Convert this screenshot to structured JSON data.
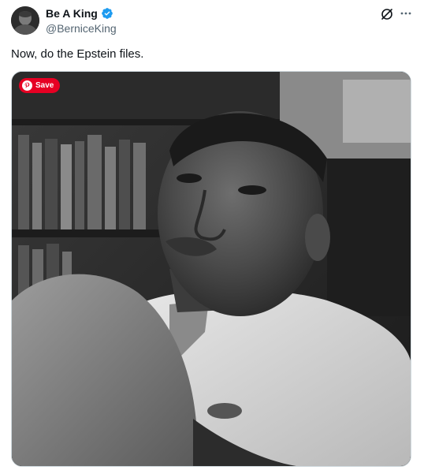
{
  "author": {
    "display_name": "Be A King",
    "handle": "@BerniceKing",
    "verified": true,
    "avatar_icon": "profile-photo"
  },
  "post": {
    "text": "Now, do the Epstein files."
  },
  "media": {
    "save_label": "Save",
    "save_color": "#e60023",
    "overlay_icon": "pinterest-icon"
  },
  "header_icons": [
    "grok-icon",
    "more-icon"
  ],
  "colors": {
    "text": "#0f1419",
    "secondary": "#536471",
    "verified": "#1d9bf0",
    "border": "#cfd9de"
  }
}
